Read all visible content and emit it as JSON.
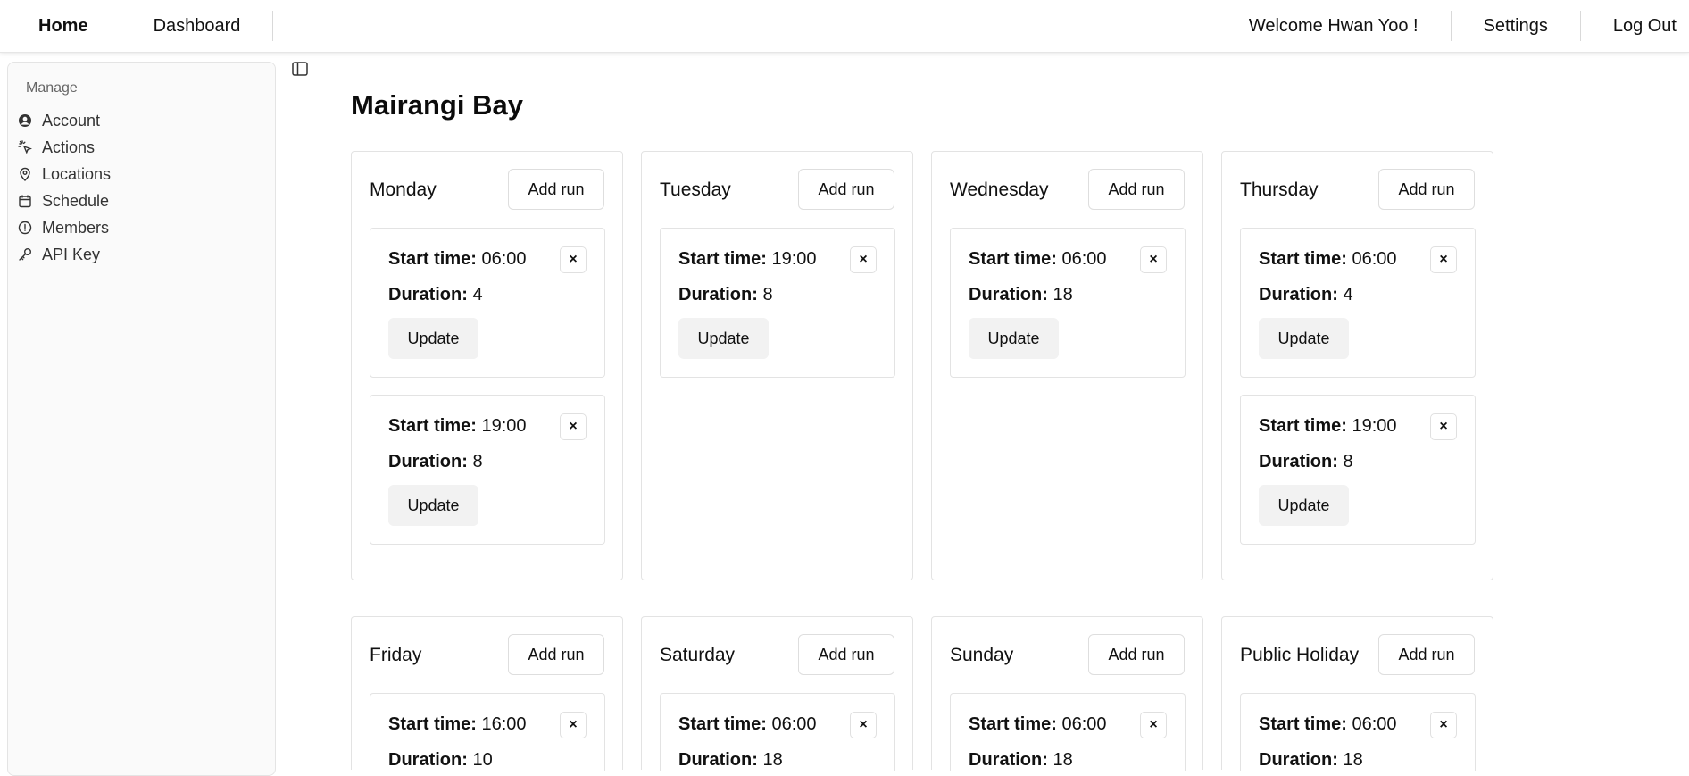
{
  "nav": {
    "home": "Home",
    "dashboard": "Dashboard",
    "welcome": "Welcome Hwan Yoo !",
    "settings": "Settings",
    "logout": "Log Out"
  },
  "sidebar": {
    "group_label": "Manage",
    "items": [
      {
        "label": "Account",
        "icon": "user-circle-icon"
      },
      {
        "label": "Actions",
        "icon": "pointer-click-icon"
      },
      {
        "label": "Locations",
        "icon": "map-pin-icon"
      },
      {
        "label": "Schedule",
        "icon": "calendar-icon"
      },
      {
        "label": "Members",
        "icon": "alert-circle-icon"
      },
      {
        "label": "API Key",
        "icon": "key-icon"
      }
    ]
  },
  "page": {
    "title": "Mairangi Bay"
  },
  "labels": {
    "add_run": "Add run",
    "start_time": "Start time:",
    "duration": "Duration:",
    "update": "Update",
    "close": "×"
  },
  "days": [
    {
      "name": "Monday",
      "runs": [
        {
          "start": "06:00",
          "duration": "4"
        },
        {
          "start": "19:00",
          "duration": "8"
        }
      ]
    },
    {
      "name": "Tuesday",
      "runs": [
        {
          "start": "19:00",
          "duration": "8"
        }
      ]
    },
    {
      "name": "Wednesday",
      "runs": [
        {
          "start": "06:00",
          "duration": "18"
        }
      ]
    },
    {
      "name": "Thursday",
      "runs": [
        {
          "start": "06:00",
          "duration": "4"
        },
        {
          "start": "19:00",
          "duration": "8"
        }
      ]
    },
    {
      "name": "Friday",
      "runs": [
        {
          "start": "16:00",
          "duration": "10"
        }
      ]
    },
    {
      "name": "Saturday",
      "runs": [
        {
          "start": "06:00",
          "duration": "18"
        }
      ]
    },
    {
      "name": "Sunday",
      "runs": [
        {
          "start": "06:00",
          "duration": "18"
        }
      ]
    },
    {
      "name": "Public Holiday",
      "runs": [
        {
          "start": "06:00",
          "duration": "18"
        }
      ]
    }
  ]
}
